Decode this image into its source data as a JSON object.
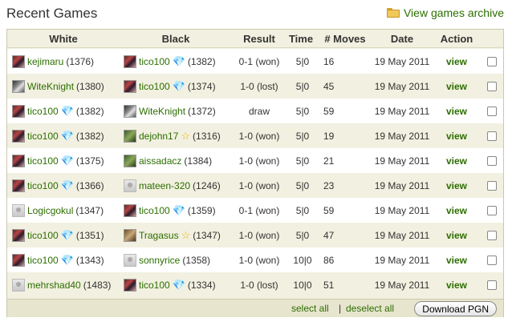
{
  "title": "Recent Games",
  "archive_link": "View games archive",
  "columns": [
    "White",
    "Black",
    "Result",
    "Time",
    "# Moves",
    "Date",
    "Action"
  ],
  "rows": [
    {
      "white": {
        "name": "kejimaru",
        "rating": "(1376)",
        "avatar": "dark",
        "badge": ""
      },
      "black": {
        "name": "tico100",
        "rating": "(1382)",
        "avatar": "dark",
        "badge": "diamond"
      },
      "result": "0-1 (won)",
      "time": "5|0",
      "moves": "16",
      "date": "19 May 2011",
      "action": "view"
    },
    {
      "white": {
        "name": "WiteKnight",
        "rating": "(1380)",
        "avatar": "knight",
        "badge": ""
      },
      "black": {
        "name": "tico100",
        "rating": "(1374)",
        "avatar": "dark",
        "badge": "diamond"
      },
      "result": "1-0 (lost)",
      "time": "5|0",
      "moves": "45",
      "date": "19 May 2011",
      "action": "view"
    },
    {
      "white": {
        "name": "tico100",
        "rating": "(1382)",
        "avatar": "dark",
        "badge": "diamond"
      },
      "black": {
        "name": "WiteKnight",
        "rating": "(1372)",
        "avatar": "knight",
        "badge": ""
      },
      "result": "draw",
      "time": "5|0",
      "moves": "59",
      "date": "19 May 2011",
      "action": "view"
    },
    {
      "white": {
        "name": "tico100",
        "rating": "(1382)",
        "avatar": "dark",
        "badge": "diamond"
      },
      "black": {
        "name": "dejohn17",
        "rating": "(1316)",
        "avatar": "green",
        "badge": "star"
      },
      "result": "1-0 (won)",
      "time": "5|0",
      "moves": "19",
      "date": "19 May 2011",
      "action": "view"
    },
    {
      "white": {
        "name": "tico100",
        "rating": "(1375)",
        "avatar": "dark",
        "badge": "diamond"
      },
      "black": {
        "name": "aissadacz",
        "rating": "(1384)",
        "avatar": "green",
        "badge": ""
      },
      "result": "1-0 (won)",
      "time": "5|0",
      "moves": "21",
      "date": "19 May 2011",
      "action": "view"
    },
    {
      "white": {
        "name": "tico100",
        "rating": "(1366)",
        "avatar": "dark",
        "badge": "diamond"
      },
      "black": {
        "name": "mateen-320",
        "rating": "(1246)",
        "avatar": "grey",
        "badge": ""
      },
      "result": "1-0 (won)",
      "time": "5|0",
      "moves": "23",
      "date": "19 May 2011",
      "action": "view"
    },
    {
      "white": {
        "name": "Logicgokul",
        "rating": "(1347)",
        "avatar": "grey",
        "badge": ""
      },
      "black": {
        "name": "tico100",
        "rating": "(1359)",
        "avatar": "dark",
        "badge": "diamond"
      },
      "result": "0-1 (won)",
      "time": "5|0",
      "moves": "59",
      "date": "19 May 2011",
      "action": "view"
    },
    {
      "white": {
        "name": "tico100",
        "rating": "(1351)",
        "avatar": "dark",
        "badge": "diamond"
      },
      "black": {
        "name": "Tragasus",
        "rating": "(1347)",
        "avatar": "brown",
        "badge": "star"
      },
      "result": "1-0 (won)",
      "time": "5|0",
      "moves": "47",
      "date": "19 May 2011",
      "action": "view"
    },
    {
      "white": {
        "name": "tico100",
        "rating": "(1343)",
        "avatar": "dark",
        "badge": "diamond"
      },
      "black": {
        "name": "sonnyrice",
        "rating": "(1358)",
        "avatar": "grey",
        "badge": ""
      },
      "result": "1-0 (won)",
      "time": "10|0",
      "moves": "86",
      "date": "19 May 2011",
      "action": "view"
    },
    {
      "white": {
        "name": "mehrshad40",
        "rating": "(1483)",
        "avatar": "grey",
        "badge": ""
      },
      "black": {
        "name": "tico100",
        "rating": "(1334)",
        "avatar": "dark",
        "badge": "diamond"
      },
      "result": "1-0 (lost)",
      "time": "10|0",
      "moves": "51",
      "date": "19 May 2011",
      "action": "view"
    }
  ],
  "footer": {
    "select_all": "select all",
    "separator": "|",
    "deselect_all": "deselect all",
    "download": "Download PGN"
  },
  "colors": {
    "link": "#2c6e00",
    "panel": "#f2f0e0",
    "diamond": "#4aa0e8",
    "star": "#e8b800"
  },
  "icons": {
    "archive": "folder-icon",
    "diamond": "diamond-icon",
    "star": "star-icon"
  }
}
